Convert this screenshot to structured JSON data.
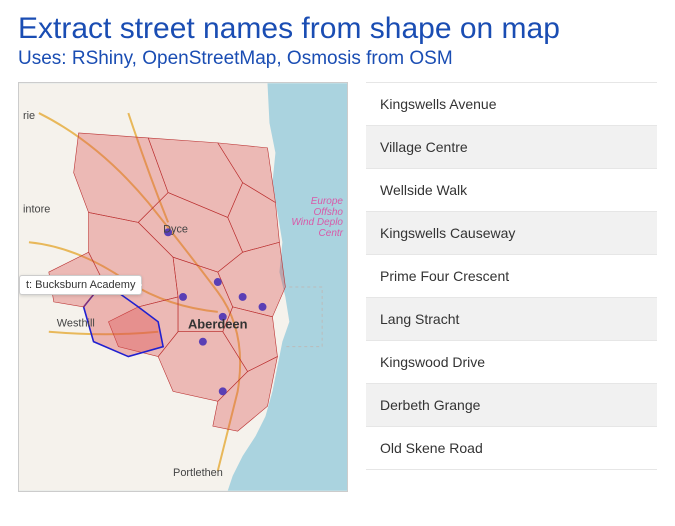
{
  "header": {
    "title": "Extract street names from shape on map",
    "subtitle": "Uses: RShiny, OpenStreetMap, Osmosis from OSM"
  },
  "map": {
    "tooltip": "t: Bucksburn Academy",
    "overlay_label": {
      "l1": "Europe",
      "l2": "Offsho",
      "l3": "Wind Deplo",
      "l4": "Centr"
    },
    "places": {
      "dyce": "Dyce",
      "aberdeen": "Aberdeen",
      "westhill": "Westhill",
      "portlethen": "Portlethen",
      "kintore": "intore",
      "rie": "rie"
    }
  },
  "streets": [
    "Kingswells Avenue",
    "Village Centre",
    "Wellside Walk",
    "Kingswells Causeway",
    "Prime Four Crescent",
    "Lang Stracht",
    "Kingswood Drive",
    "Derbeth Grange",
    "Old Skene Road"
  ]
}
